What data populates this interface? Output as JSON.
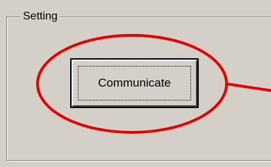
{
  "group": {
    "title": "Setting"
  },
  "button": {
    "label": "Communicate"
  },
  "annotation": {
    "color": "#e60000"
  }
}
